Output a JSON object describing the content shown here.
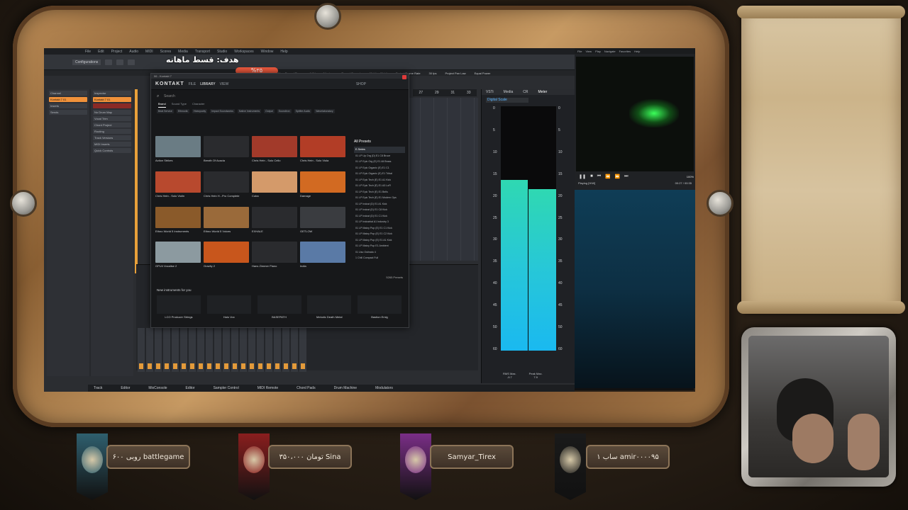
{
  "stream": {
    "goal_label": "هدف: قسط ماهانه",
    "goal_percent": "%۲۵",
    "goal_progress": 0.25
  },
  "daw": {
    "menu": [
      "File",
      "Edit",
      "Project",
      "Audio",
      "MIDI",
      "Scores",
      "Media",
      "Transport",
      "Studio",
      "Workspaces",
      "Window",
      "Help"
    ],
    "toolbar_preset": "Configurations",
    "status": {
      "max_record_time": "Max. Record Time",
      "record_time_value": "146 hours 04 mins",
      "record_format_label": "Record Format",
      "record_format_value": "48 kHz - 24 bit",
      "project_frame_rate_label": "Project Frame Rate",
      "project_frame_rate_value": "30 fps",
      "project_pan_law_label": "Project Pan Law",
      "project_pan_law_value": "Equal Power"
    },
    "inspector": {
      "tabs": [
        "Channel",
        "Inspector",
        "Visibility"
      ],
      "track_name": "Kontakt 7 01",
      "sections": [
        "Routing",
        "Track Versions",
        "MIDI Inserts",
        "Quick Controls"
      ],
      "items": [
        "Kontakt 7 01",
        "No Drum Map",
        "Vocal Trim",
        "Chord Project",
        "Inserts",
        "Sends"
      ]
    },
    "ruler_marks": [
      "27",
      "29",
      "31",
      "33"
    ],
    "bottom_tabs": [
      "Track",
      "Editor",
      "MixConsole",
      "Editor",
      "Sampler Control",
      "MIDI Remote",
      "Chord Pads",
      "Drum Machine",
      "Modulators"
    ]
  },
  "meter": {
    "tabs": [
      "VSTi",
      "Media",
      "CR",
      "Meter"
    ],
    "scale_type": "Digital Scale",
    "scale_marks": [
      "0",
      "5",
      "10",
      "15",
      "20",
      "25",
      "30",
      "35",
      "40",
      "45",
      "50",
      "60"
    ],
    "left_level": 0.7,
    "right_level": 0.66,
    "rms_label": "RMS Max.",
    "rms_value": "-9.7",
    "peak_label": "Peak Max.",
    "peak_value": "7.9",
    "footer_tabs": [
      "Meter",
      "Loudness"
    ]
  },
  "kontakt": {
    "window_title": "06 - Kontakt 7",
    "logo": "KONTAKT",
    "nav": [
      "FILE",
      "LIBRARY",
      "VIEW"
    ],
    "shop": "SHOP",
    "search_placeholder": "Search",
    "filter_tabs": [
      "Brand",
      "Sound Type",
      "Character"
    ],
    "tags": [
      "Beat Service",
      "Ethnoclic",
      "Heavyocity",
      "Impact Soundworks",
      "Native Instruments",
      "Output",
      "Soundiron",
      "Spitfire Audio",
      "Wavelaboratory"
    ],
    "tiles": [
      {
        "label": "Action Strikes",
        "color": "#6a7c84"
      },
      {
        "label": "Breath Of Acacia",
        "color": "#2a2b2e"
      },
      {
        "label": "Chris Hein - Solo Cello",
        "color": "#a23a2a"
      },
      {
        "label": "Chris Hein - Solo Viola",
        "color": "#b23d26"
      },
      {
        "label": "Chris Hein - Solo Violin",
        "color": "#b8492e"
      },
      {
        "label": "Chris Hein H...Pro Complete",
        "color": "#2a2b2e"
      },
      {
        "label": "Cuba",
        "color": "#d49a6a"
      },
      {
        "label": "Damage",
        "color": "#d26a22"
      },
      {
        "label": "Ethno World 5 Instruments",
        "color": "#8a5a2a"
      },
      {
        "label": "Ethno World 5 Voices",
        "color": "#9a6a3a"
      },
      {
        "label": "EXHALE",
        "color": "#2a2b2e"
      },
      {
        "label": "GETLOW",
        "color": "#3a3c40"
      },
      {
        "label": "GPU4 Vocalise 2",
        "color": "#8c9aa0"
      },
      {
        "label": "Gravity 2",
        "color": "#c8561c"
      },
      {
        "label": "Hans Zimmer Piano",
        "color": "#2a2b2e"
      },
      {
        "label": "India",
        "color": "#5a7aa6"
      }
    ],
    "presets_title": "All Presets",
    "presets": [
      "E-Series",
      "01 LP Up Org (D) E1 C8 Bruce",
      "01 LP Epic Org (E) E1 All Brass",
      "01 LP Epic Organic (E) E1 C1",
      "01 LP Epic Organic (E) E1 Tribal",
      "01 LP Epic Tech (E) E1 A1 Kick",
      "01 LP Epic Tech (E) E1 A3 LoFi",
      "01 LP Epic Tech (E) E1 Bells",
      "01 LP Epic Tech (E) E1 Modern Ops",
      "01 LP Indust (D) E1 A1 Kick",
      "01 LP Indust (D) E1 C8 Kick",
      "01 LP Indust (D) E1 C1 Kick",
      "01 LP Industrial A1 Industry 3",
      "01 LP Mainy Pop (E) E1 C1 Kick",
      "01 LP Mainy Pop (E) E1 C2 Kick",
      "01 LP Mainy Pop (E) E1 A1 Kick",
      "01 LP Mainy Pop E1 Ambient",
      "01 Uso Ostinato 4",
      "1 Chill Compact Full"
    ],
    "results_count": "5265 Presets",
    "new_title": "New instruments for you",
    "new_items": [
      "LCO Producer Strings",
      "Halo Vox",
      "BASEPATH",
      "Melodic Death Metal",
      "Bastion Emig"
    ]
  },
  "player": {
    "menu": [
      "File",
      "View",
      "Play",
      "Navigate",
      "Favorites",
      "Help"
    ],
    "status_left": "Playing [H/W]",
    "status_right": "00:27 / 00:35",
    "volume": "100%"
  },
  "banners": [
    {
      "text": "۶۰۰ روبی battlegame",
      "color": "#2f5f6e"
    },
    {
      "text": "۳۵۰،۰۰۰ تومان Sina",
      "color": "#8a1e1e"
    },
    {
      "text": "Samyar_Tirex",
      "color": "#7a2e86"
    },
    {
      "text": "۱ ساب amir۰۰۰۰۹۵",
      "color": "#1a1a1a"
    }
  ]
}
